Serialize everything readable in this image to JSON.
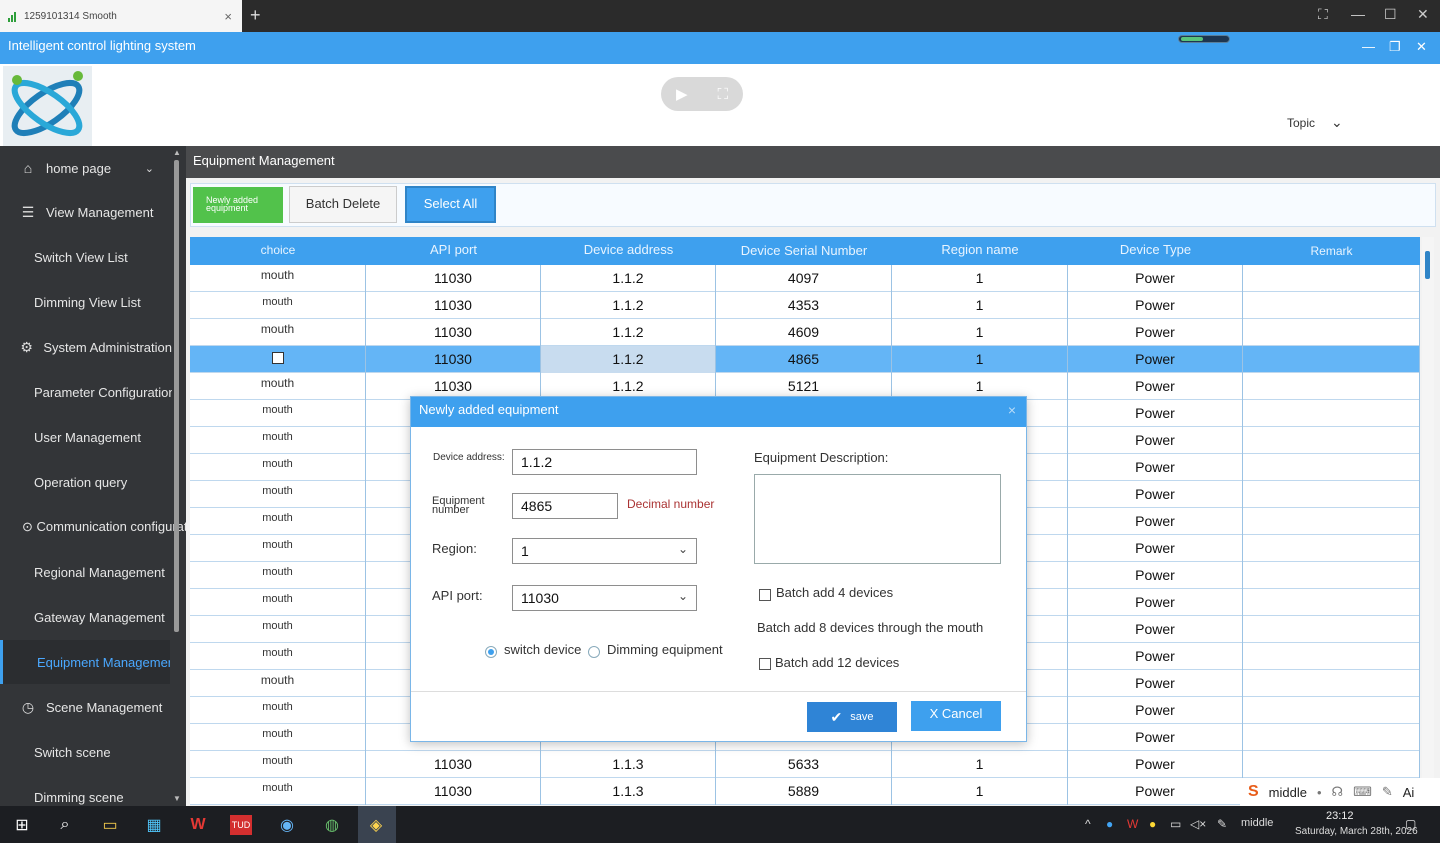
{
  "browser": {
    "tab_title": "1259101314 Smooth",
    "close_glyph": "×",
    "new_tab_glyph": "+",
    "window_controls": [
      "⛶",
      "—",
      "☐",
      "✕"
    ]
  },
  "app": {
    "title": "Intelligent control lighting system",
    "controls": [
      "—",
      "❐",
      "✕"
    ]
  },
  "header": {
    "topic_label": "Topic",
    "topic_chevron": "⌄",
    "video_icons": [
      "▶",
      "⛶"
    ]
  },
  "sidebar": {
    "items": [
      {
        "label": "home page",
        "icon": "⌂",
        "chev": "⌄"
      },
      {
        "label": "View Management",
        "icon": "☰"
      },
      {
        "label": "Switch View List"
      },
      {
        "label": "Dimming View List"
      },
      {
        "label": "System Administration",
        "icon": "⚙"
      },
      {
        "label": "Parameter Configuration"
      },
      {
        "label": "User Management"
      },
      {
        "label": "Operation query"
      },
      {
        "label": "⊙ Communication configuration"
      },
      {
        "label": "Regional Management"
      },
      {
        "label": "Gateway Management"
      },
      {
        "label": "Equipment Management"
      },
      {
        "label": "Scene Management",
        "icon": "◷"
      },
      {
        "label": "Switch scene"
      },
      {
        "label": "Dimming scene"
      }
    ],
    "scroll_up": "▲",
    "scroll_down": "▼"
  },
  "main": {
    "title": "Equipment Management",
    "buttons": {
      "new_line1": "Newly added",
      "new_line2": "equipment",
      "batch_delete": "Batch Delete",
      "select_all": "Select All"
    }
  },
  "table": {
    "headers": [
      "choice",
      "API port",
      "Device address",
      "Device Serial Number",
      "Region name",
      "Device Type",
      "Remark"
    ],
    "rows": [
      [
        "mouth",
        "11030",
        "1.1.2",
        "4097",
        "1",
        "Power",
        ""
      ],
      [
        "mouth",
        "11030",
        "1.1.2",
        "4353",
        "1",
        "Power",
        ""
      ],
      [
        "mouth",
        "11030",
        "1.1.2",
        "4609",
        "1",
        "Power",
        ""
      ],
      [
        "",
        "11030",
        "1.1.2",
        "4865",
        "1",
        "Power",
        ""
      ],
      [
        "mouth",
        "11030",
        "1.1.2",
        "5121",
        "1",
        "Power",
        ""
      ],
      [
        "mouth",
        "",
        "",
        "",
        "",
        "Power",
        ""
      ],
      [
        "mouth",
        "",
        "",
        "",
        "",
        "Power",
        ""
      ],
      [
        "mouth",
        "",
        "",
        "",
        "",
        "Power",
        ""
      ],
      [
        "mouth",
        "",
        "",
        "",
        "",
        "Power",
        ""
      ],
      [
        "mouth",
        "",
        "",
        "",
        "",
        "Power",
        ""
      ],
      [
        "mouth",
        "",
        "",
        "",
        "",
        "Power",
        ""
      ],
      [
        "mouth",
        "",
        "",
        "",
        "",
        "Power",
        ""
      ],
      [
        "mouth",
        "",
        "",
        "",
        "",
        "Power",
        ""
      ],
      [
        "mouth",
        "",
        "",
        "",
        "",
        "Power",
        ""
      ],
      [
        "mouth",
        "",
        "",
        "",
        "",
        "Power",
        ""
      ],
      [
        "mouth",
        "",
        "",
        "",
        "",
        "Power",
        ""
      ],
      [
        "mouth",
        "",
        "",
        "",
        "",
        "Power",
        ""
      ],
      [
        "mouth",
        "",
        "",
        "",
        "",
        "Power",
        ""
      ],
      [
        "mouth",
        "11030",
        "1.1.3",
        "5633",
        "1",
        "Power",
        ""
      ],
      [
        "mouth",
        "11030",
        "1.1.3",
        "5889",
        "1",
        "Power",
        ""
      ]
    ]
  },
  "dialog": {
    "title": "Newly added equipment",
    "close": "×",
    "device_address_label": "Device address:",
    "device_address_value": "1.1.2",
    "equipment_number_label": "Equipment number",
    "equipment_number_value": "4865",
    "decimal_hint": "Decimal number",
    "region_label": "Region:",
    "region_value": "1",
    "api_port_label": "API port:",
    "api_port_value": "11030",
    "select_arrow": "⌄",
    "radio_switch": "switch device",
    "radio_dimming": "Dimming equipment",
    "description_label": "Equipment Description:",
    "batch4": "Batch add 4 devices",
    "batch8": "Batch add 8 devices through the mouth",
    "batch12": "Batch add 12 devices",
    "save": "save",
    "save_icon": "✔",
    "cancel": "X Cancel"
  },
  "ime": {
    "logo": "S",
    "text": "middle",
    "glyphs": [
      "•",
      "☊",
      "⌨",
      "✎",
      "Ai"
    ]
  },
  "taskbar": {
    "tray_text": "middle",
    "time": "23:12",
    "date": "Saturday, March 28th, 2026",
    "icons": [
      "⊞",
      "⌕",
      "▭",
      "▦",
      "W",
      "TUD",
      "◉",
      "◍",
      "◈"
    ],
    "tray_icons": [
      "^",
      "●",
      "W",
      "●",
      "▭",
      "◁×",
      "✎",
      "▢"
    ]
  },
  "colors": {
    "accent": "#3ea0ee",
    "sidebar_bg": "#333538",
    "new_button": "#52c24b",
    "selected_row": "#64b5f6",
    "hint_red": "#aa3333"
  }
}
